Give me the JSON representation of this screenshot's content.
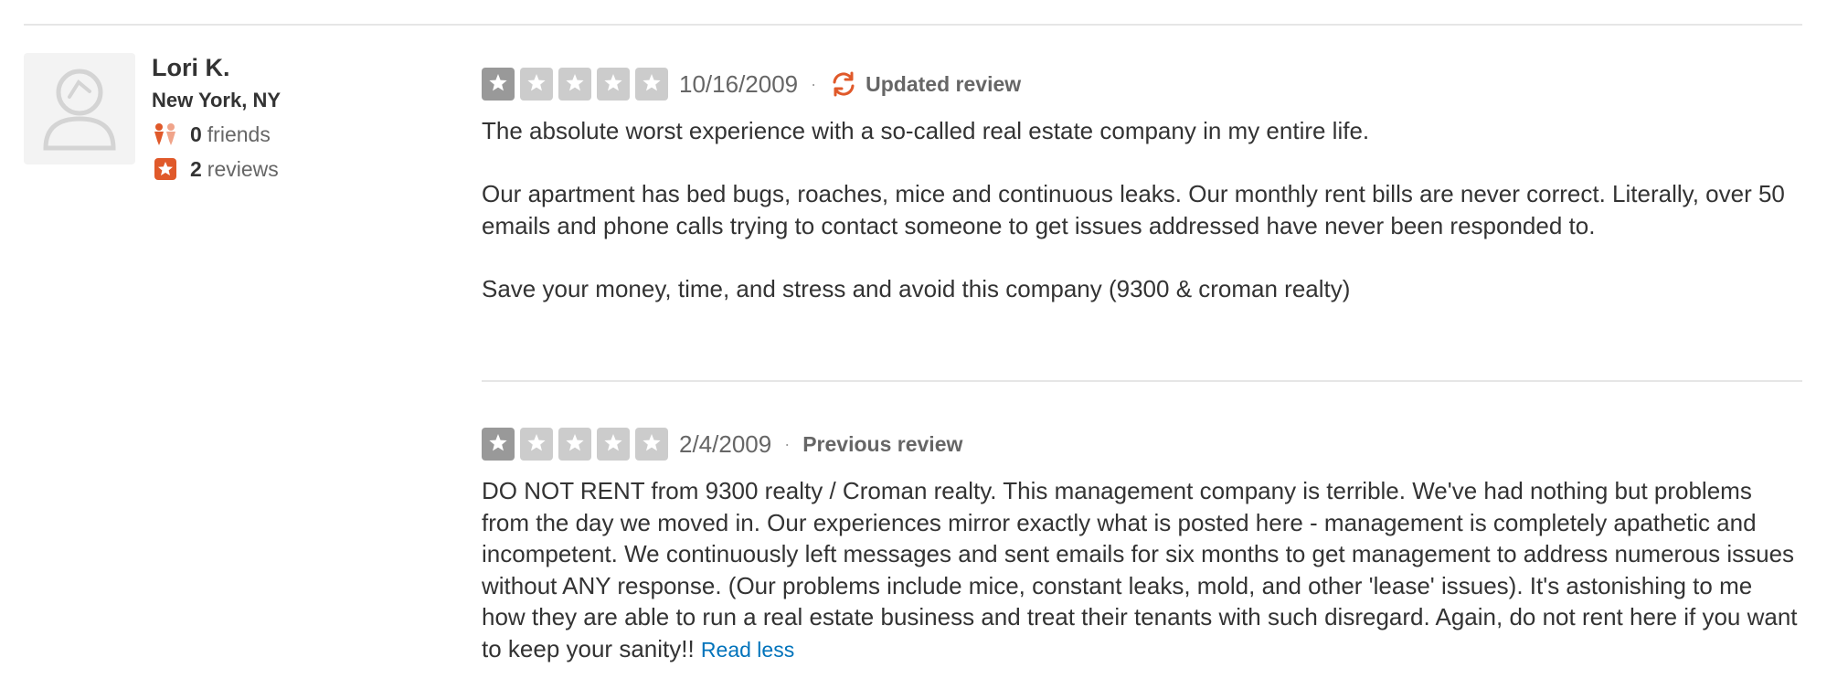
{
  "user": {
    "name": "Lori K.",
    "location": "New York, NY",
    "friends_count": "0",
    "friends_label": "friends",
    "reviews_count": "2",
    "reviews_label": "reviews",
    "avatar_icon": "default-avatar-icon",
    "friends_icon": "friends-icon",
    "reviews_icon": "star-badge-icon"
  },
  "reviews": [
    {
      "rating": 1,
      "max_rating": 5,
      "date": "10/16/2009",
      "separator": "·",
      "label": "Updated review",
      "label_icon": "refresh-icon",
      "paragraphs": [
        "The absolute worst experience with a so-called real estate company in my entire life.",
        "Our apartment has bed bugs, roaches, mice and continuous leaks.  Our monthly rent bills are never correct.  Literally, over 50 emails and phone calls trying to contact someone to get issues addressed have never been responded to.",
        "Save your money, time, and stress and avoid this company (9300 & croman realty)"
      ]
    },
    {
      "rating": 1,
      "max_rating": 5,
      "date": "2/4/2009",
      "separator": "·",
      "label": "Previous review",
      "paragraphs": [
        "DO NOT RENT from 9300 realty / Croman realty. This management company is terrible. We've had nothing but problems from the day we moved in. Our experiences mirror exactly what is posted here - management is completely apathetic and incompetent. We continuously left messages and sent emails for six months to get management to address numerous issues without ANY response. (Our problems include mice, constant leaks, mold, and other 'lease' issues). It's astonishing to me how they are able to run a real estate business and treat their tenants with such disregard. Again, do not rent here if you want to keep your sanity!!"
      ],
      "read_less": "Read less"
    }
  ],
  "colors": {
    "star_filled": "#999999",
    "star_empty": "#cccccc",
    "accent_orange": "#e0592a",
    "link_blue": "#0073bb",
    "divider": "#e6e6e6"
  }
}
